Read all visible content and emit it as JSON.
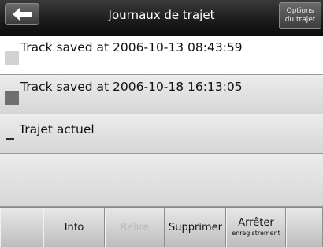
{
  "header": {
    "title": "Journaux de trajet",
    "options_line1": "Options",
    "options_line2": "du trajet"
  },
  "tracks": [
    {
      "label": "Track saved at 2006-10-13 08:43:59",
      "color": "#d2d2d2"
    },
    {
      "label": "Track saved at 2006-10-18 16:13:05",
      "color": "#6f6f6f"
    },
    {
      "label": "Trajet actuel",
      "color": "#2a2a2a"
    }
  ],
  "toolbar": {
    "info": "Info",
    "replay": "Relire",
    "delete": "Supprimer",
    "stop_line1": "Arrêter",
    "stop_line2": "enregistrement"
  }
}
